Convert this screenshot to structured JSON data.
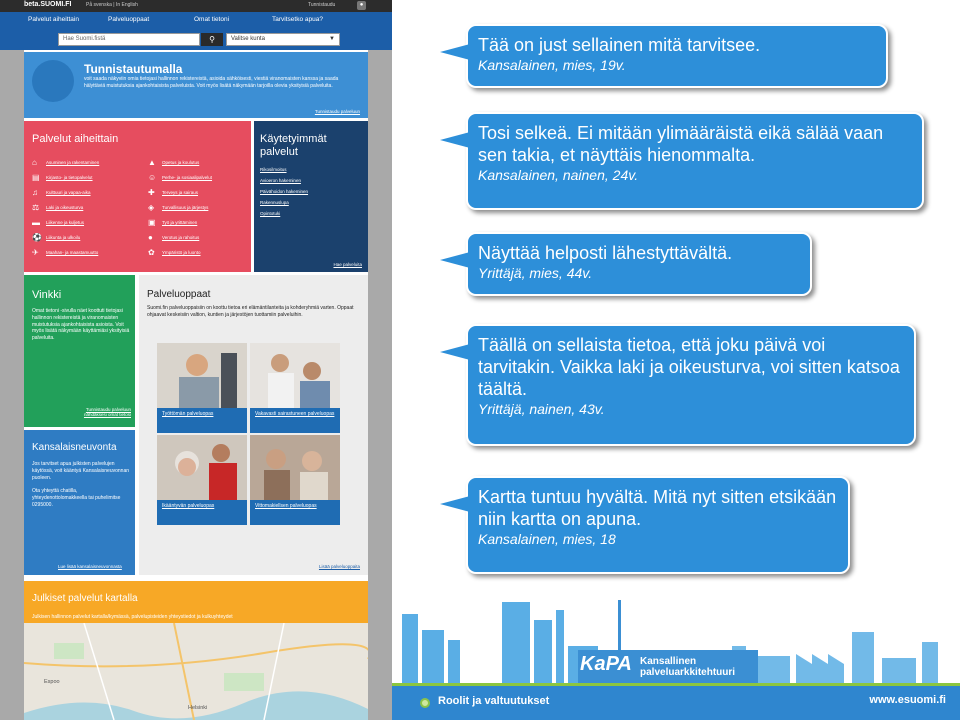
{
  "site": {
    "topbar": {
      "logo": "beta.SUOMI.FI",
      "langs": "På svenska | In English",
      "login": "Tunnistaudu",
      "lock_icon": "lock-icon"
    },
    "nav": [
      "Palvelut aiheittain",
      "Palveluoppaat",
      "Omat tietoni",
      "Tarvitsetko apua?"
    ],
    "search": {
      "placeholder": "Hae Suomi.fistä",
      "municipality": "Valitse kunta"
    },
    "tunnistautuminen": {
      "title": "Tunnistautumalla",
      "text": "voit saada näkyviin omia tietojasi hallinnon rekistereistä, asioida sähköisesti, viestiä viranomaisten kanssa ja saada hälyttäviä muistutuksia ajankohtaisista palveluista. Voit myös lisätä näkymään tarjoilla olevia yksityisiä palveluita.",
      "link": "Tunnistaudu palveluun"
    },
    "palvelut": {
      "title": "Palvelut aiheittain",
      "left": [
        {
          "icon": "home-icon",
          "label": "Asuminen ja rakentaminen"
        },
        {
          "icon": "book-icon",
          "label": "Kirjasto- ja tietopalvelut"
        },
        {
          "icon": "culture-icon",
          "label": "Kulttuuri ja vapaa-aika"
        },
        {
          "icon": "scales-icon",
          "label": "Laki ja oikeusturva"
        },
        {
          "icon": "car-icon",
          "label": "Liikenne ja kuljetus"
        },
        {
          "icon": "sport-icon",
          "label": "Liikunta ja ulkoilu"
        },
        {
          "icon": "plane-icon",
          "label": "Maahan- ja maastamuutto"
        }
      ],
      "right": [
        {
          "icon": "education-icon",
          "label": "Opetus ja koulutus"
        },
        {
          "icon": "family-icon",
          "label": "Perhe- ja sosiaalipalvelut"
        },
        {
          "icon": "health-icon",
          "label": "Terveys ja sairaus"
        },
        {
          "icon": "shield-icon",
          "label": "Turvallisuus ja järjestys"
        },
        {
          "icon": "work-icon",
          "label": "Työ ja yrittäminen"
        },
        {
          "icon": "tax-icon",
          "label": "Verotus ja rahoitus"
        },
        {
          "icon": "leaf-icon",
          "label": "Ympäristö ja luonto"
        }
      ]
    },
    "kaytetyimmat": {
      "title": "Käytetyimmät palvelut",
      "links": [
        "Rikosilmoitus",
        "Avioeron hakeminen",
        "Päivähoidon hakeminen",
        "Rakennuslupa",
        "Opintotuki"
      ],
      "more": "Hae palveluita"
    },
    "vinkki": {
      "title": "Vinkki",
      "text": "Omat tietoni -sivulla näet koottuti tietojasi hallinnon rekistereistä ja viranomaisten muistutuksia ajankohtaisista asioista. Voit myös lisätä näkymään käyttämiäsi yksityisiä palveluita.",
      "link": "Tunnistaudu palveluun nähdäksesi omat tietosi"
    },
    "kansalaisneuvonta": {
      "title": "Kansalaisneuvonta",
      "text": "Jos tarvitset apua julkisten palvelujen käytössä, voit kääntyä Kansalaisneuvonnan puoleen.",
      "text2": "Ota yhteyttä chatilla, yhteydenottolomakkeella tai puhelimitse 0295000.",
      "link": "Lue lisää kansalaisneuvonnasta"
    },
    "palveluoppaat": {
      "title": "Palveluoppaat",
      "text": "Suomi.fin palveluoppaisiin on koottu tietoa eri elämäntilanteita ja kohderyhmiä varten. Oppaat ohjaavat keskeisiin valtion, kuntien ja järjestöjen tuottamiin palveluihin.",
      "tiles": [
        "Työttömän palveluopas",
        "Vakavasti sairastuneen palveluopas",
        "Ikääntyvän palveluopas",
        "Vittomakiellsen palveluopas"
      ],
      "more": "Lisää palveluoppaita"
    },
    "kartta": {
      "title": "Julkiset palvelut kartalla",
      "text": "Julkisen hallinnon palvelut kartalla/kymässä, palvelupisteiden yhteystiedot ja kulkuyhteydet",
      "places": [
        "Espoo",
        "Helsinki"
      ]
    }
  },
  "quotes": [
    {
      "quote": "Tää on just sellainen mitä tarvitsee.",
      "who": "Kansalainen, mies, 19v."
    },
    {
      "quote": "Tosi selkeä. Ei mitään ylimääräistä eikä sälää vaan sen takia, et näyttäis hienommalta.",
      "who": "Kansalainen, nainen, 24v."
    },
    {
      "quote": "Näyttää helposti lähestyttävältä.",
      "who": "Yrittäjä, mies, 44v."
    },
    {
      "quote": "Täällä on sellaista tietoa, että joku päivä voi tarvitakin. Vaikka laki ja oikeusturva, voi sitten katsoa täältä.",
      "who": "Yrittäjä, nainen, 43v."
    },
    {
      "quote": "Kartta tuntuu hyvältä. Mitä nyt sitten etsikään niin kartta on apuna.",
      "who": "Kansalainen, mies, 18"
    }
  ],
  "footer": {
    "kapa_mark": "KaPA",
    "kapa_title": "Kansallinen palveluarkkitehtuuri",
    "roles": "Roolit ja valtuutukset",
    "url": "www.esuomi.fi"
  },
  "colors": {
    "bubble": "#2d8fd9",
    "palvelut": "#e64d5f",
    "kaytetyimmat": "#1b416d",
    "vinkki": "#22a05a",
    "kartta": "#f7a826"
  }
}
